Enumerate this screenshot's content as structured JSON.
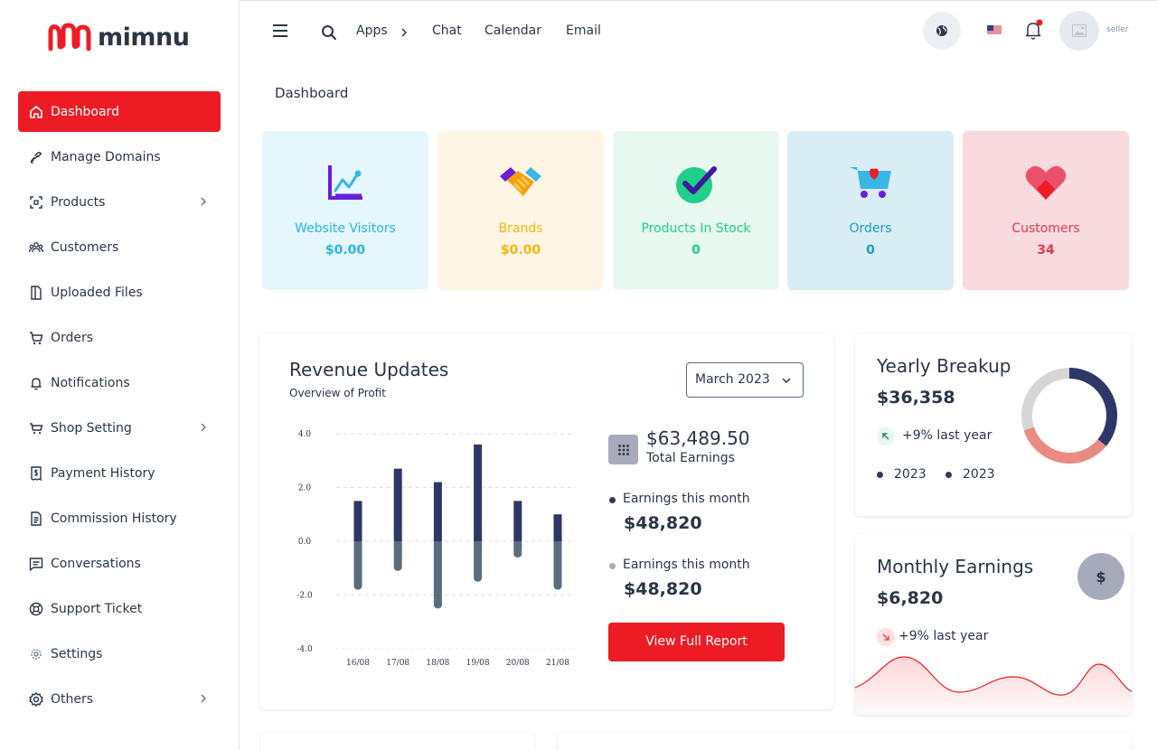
{
  "brand": {
    "name": "mimnu",
    "accent": "#ed1c24"
  },
  "sidebar": {
    "items": [
      {
        "label": "Dashboard",
        "icon": "home-icon",
        "active": true
      },
      {
        "label": "Manage Domains",
        "icon": "link-icon"
      },
      {
        "label": "Products",
        "icon": "box-scan-icon",
        "has_children": true
      },
      {
        "label": "Customers",
        "icon": "users-icon"
      },
      {
        "label": "Uploaded Files",
        "icon": "file-icon"
      },
      {
        "label": "Orders",
        "icon": "cart-icon"
      },
      {
        "label": "Notifications",
        "icon": "bell-icon"
      },
      {
        "label": "Shop Setting",
        "icon": "shopping-cart-icon",
        "has_children": true
      },
      {
        "label": "Payment History",
        "icon": "receipt-icon"
      },
      {
        "label": "Commission History",
        "icon": "document-icon"
      },
      {
        "label": "Conversations",
        "icon": "message-icon"
      },
      {
        "label": "Support Ticket",
        "icon": "lifebuoy-icon"
      },
      {
        "label": "Settings",
        "icon": "gear-icon"
      },
      {
        "label": "Others",
        "icon": "settings-icon",
        "has_children": true
      }
    ]
  },
  "header": {
    "links": {
      "apps": "Apps",
      "chat": "Chat",
      "calendar": "Calendar",
      "email": "Email"
    },
    "user": {
      "name": "seller"
    }
  },
  "page": {
    "title": "Dashboard"
  },
  "stats": [
    {
      "label": "Website Visitors",
      "value": "$0.00",
      "bg": "#e5f6fd",
      "color": "#2ab5e6"
    },
    {
      "label": "Brands",
      "value": "$0.00",
      "bg": "#fef5e5",
      "color": "#f5b70e"
    },
    {
      "label": "Products In Stock",
      "value": "0",
      "bg": "#e6f8f0",
      "color": "#1fcf8a"
    },
    {
      "label": "Orders",
      "value": "0",
      "bg": "#d9edf4",
      "color": "#1a9cc6"
    },
    {
      "label": "Customers",
      "value": "34",
      "bg": "#f8dadf",
      "color": "#e23b4a"
    }
  ],
  "revenue": {
    "title": "Revenue Updates",
    "subtitle": "Overview of Profit",
    "month": "March 2023",
    "total_value": "$63,489.50",
    "total_label": "Total Earnings",
    "rows": [
      {
        "label": "Earnings this month",
        "value": "$48,820",
        "dot": "#2e3768"
      },
      {
        "label": "Earnings this month",
        "value": "$48,820",
        "dot": "#a7aabb"
      }
    ],
    "button": "View Full Report"
  },
  "chart_data": {
    "type": "bar",
    "categories": [
      "16/08",
      "17/08",
      "18/08",
      "19/08",
      "20/08",
      "21/08"
    ],
    "series": [
      {
        "values": [
          1.5,
          2.7,
          2.2,
          3.6,
          1.5,
          1.0
        ],
        "color": "#2e3768"
      },
      {
        "values": [
          -1.8,
          -1.1,
          -2.5,
          -1.5,
          -0.6,
          -1.8
        ],
        "color": "#5a6d7c"
      }
    ],
    "ylim": [
      -4,
      4
    ],
    "yticks": [
      "4.0",
      "2.0",
      "0.0",
      "-2.0",
      "-4.0"
    ],
    "stacked": true,
    "grid": true
  },
  "yearly": {
    "title": "Yearly Breakup",
    "value": "$36,358",
    "pct": "+9% last year",
    "legend": [
      "2023",
      "2023"
    ],
    "donut": {
      "segments": [
        0.36,
        0.34,
        0.3
      ],
      "colors": [
        "#2e3768",
        "#ea8a83",
        "#d6d6d6"
      ]
    }
  },
  "monthly": {
    "title": "Monthly Earnings",
    "value": "$6,820",
    "pct": "+9% last year",
    "currency_symbol": "$"
  }
}
